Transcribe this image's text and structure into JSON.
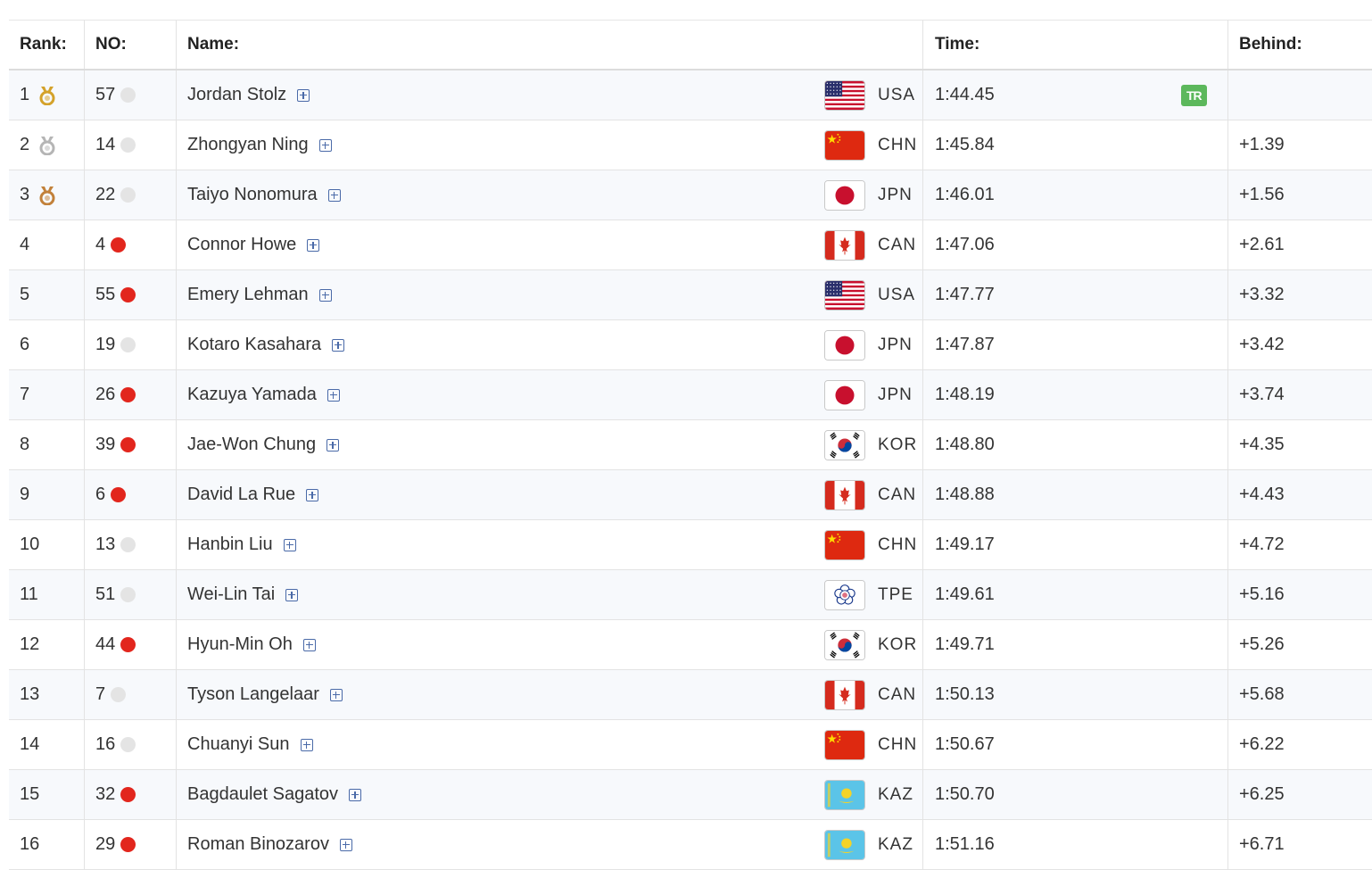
{
  "header": {
    "rank": "Rank:",
    "no": "NO:",
    "name": "Name:",
    "time": "Time:",
    "behind": "Behind:"
  },
  "colors": {
    "gold": "#d4a22a",
    "silver": "#b5b5b5",
    "bronze": "#c2813a",
    "red_dot": "#e2261d",
    "grey_dot": "#e4e4e4",
    "tag_green": "#5cb85c",
    "plus_blue": "#4a6aa8"
  },
  "rows": [
    {
      "rank": "1",
      "medal": "gold",
      "no": "57",
      "dot": "grey",
      "name": "Jordan Stolz",
      "flag": "usa",
      "code": "USA",
      "time": "1:44.45",
      "tag": "TR",
      "behind": ""
    },
    {
      "rank": "2",
      "medal": "silver",
      "no": "14",
      "dot": "grey",
      "name": "Zhongyan Ning",
      "flag": "chn",
      "code": "CHN",
      "time": "1:45.84",
      "tag": "",
      "behind": "+1.39"
    },
    {
      "rank": "3",
      "medal": "bronze",
      "no": "22",
      "dot": "grey",
      "name": "Taiyo Nonomura",
      "flag": "jpn",
      "code": "JPN",
      "time": "1:46.01",
      "tag": "",
      "behind": "+1.56"
    },
    {
      "rank": "4",
      "medal": "",
      "no": "4",
      "dot": "red",
      "name": "Connor Howe",
      "flag": "can",
      "code": "CAN",
      "time": "1:47.06",
      "tag": "",
      "behind": "+2.61"
    },
    {
      "rank": "5",
      "medal": "",
      "no": "55",
      "dot": "red",
      "name": "Emery Lehman",
      "flag": "usa",
      "code": "USA",
      "time": "1:47.77",
      "tag": "",
      "behind": "+3.32"
    },
    {
      "rank": "6",
      "medal": "",
      "no": "19",
      "dot": "grey",
      "name": "Kotaro Kasahara",
      "flag": "jpn",
      "code": "JPN",
      "time": "1:47.87",
      "tag": "",
      "behind": "+3.42"
    },
    {
      "rank": "7",
      "medal": "",
      "no": "26",
      "dot": "red",
      "name": "Kazuya Yamada",
      "flag": "jpn",
      "code": "JPN",
      "time": "1:48.19",
      "tag": "",
      "behind": "+3.74"
    },
    {
      "rank": "8",
      "medal": "",
      "no": "39",
      "dot": "red",
      "name": "Jae-Won Chung",
      "flag": "kor",
      "code": "KOR",
      "time": "1:48.80",
      "tag": "",
      "behind": "+4.35"
    },
    {
      "rank": "9",
      "medal": "",
      "no": "6",
      "dot": "red",
      "name": "David La Rue",
      "flag": "can",
      "code": "CAN",
      "time": "1:48.88",
      "tag": "",
      "behind": "+4.43"
    },
    {
      "rank": "10",
      "medal": "",
      "no": "13",
      "dot": "grey",
      "name": "Hanbin Liu",
      "flag": "chn",
      "code": "CHN",
      "time": "1:49.17",
      "tag": "",
      "behind": "+4.72"
    },
    {
      "rank": "11",
      "medal": "",
      "no": "51",
      "dot": "grey",
      "name": "Wei-Lin Tai",
      "flag": "tpe",
      "code": "TPE",
      "time": "1:49.61",
      "tag": "",
      "behind": "+5.16"
    },
    {
      "rank": "12",
      "medal": "",
      "no": "44",
      "dot": "red",
      "name": "Hyun-Min Oh",
      "flag": "kor",
      "code": "KOR",
      "time": "1:49.71",
      "tag": "",
      "behind": "+5.26"
    },
    {
      "rank": "13",
      "medal": "",
      "no": "7",
      "dot": "grey",
      "name": "Tyson Langelaar",
      "flag": "can",
      "code": "CAN",
      "time": "1:50.13",
      "tag": "",
      "behind": "+5.68"
    },
    {
      "rank": "14",
      "medal": "",
      "no": "16",
      "dot": "grey",
      "name": "Chuanyi Sun",
      "flag": "chn",
      "code": "CHN",
      "time": "1:50.67",
      "tag": "",
      "behind": "+6.22"
    },
    {
      "rank": "15",
      "medal": "",
      "no": "32",
      "dot": "red",
      "name": "Bagdaulet Sagatov",
      "flag": "kaz",
      "code": "KAZ",
      "time": "1:50.70",
      "tag": "",
      "behind": "+6.25"
    },
    {
      "rank": "16",
      "medal": "",
      "no": "29",
      "dot": "red",
      "name": "Roman Binozarov",
      "flag": "kaz",
      "code": "KAZ",
      "time": "1:51.16",
      "tag": "",
      "behind": "+6.71"
    }
  ]
}
